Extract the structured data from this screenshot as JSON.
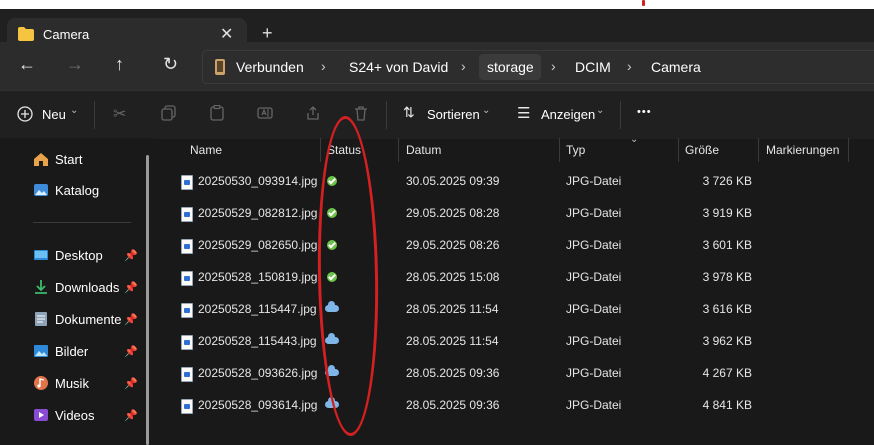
{
  "tab": {
    "title": "Camera",
    "close_icon": "close-icon",
    "new_tab_icon": "plus-icon"
  },
  "nav": {
    "back_icon": "arrow-left-icon",
    "forward_icon": "arrow-right-icon",
    "up_icon": "arrow-up-icon",
    "refresh_icon": "refresh-icon"
  },
  "breadcrumb": [
    "Verbunden",
    "S24+ von David",
    "storage",
    "DCIM",
    "Camera"
  ],
  "toolbar": {
    "new_label": "Neu",
    "sort_label": "Sortieren",
    "view_label": "Anzeigen",
    "more_label": "•••"
  },
  "sidebar": {
    "items": [
      {
        "label": "Start",
        "icon": "home-icon",
        "pinned": false
      },
      {
        "label": "Katalog",
        "icon": "gallery-icon",
        "pinned": false
      },
      {
        "label": "Desktop",
        "icon": "desktop-icon",
        "pinned": true
      },
      {
        "label": "Downloads",
        "icon": "download-icon",
        "pinned": true
      },
      {
        "label": "Dokumente",
        "icon": "document-icon",
        "pinned": true
      },
      {
        "label": "Bilder",
        "icon": "pictures-icon",
        "pinned": true
      },
      {
        "label": "Musik",
        "icon": "music-icon",
        "pinned": true
      },
      {
        "label": "Videos",
        "icon": "video-icon",
        "pinned": true
      }
    ]
  },
  "columns": {
    "name": "Name",
    "status": "Status",
    "date": "Datum",
    "type": "Typ",
    "size": "Größe",
    "tags": "Markierungen"
  },
  "files": [
    {
      "name": "20250530_093914.jpg",
      "status": "synced",
      "date": "30.05.2025 09:39",
      "type": "JPG-Datei",
      "size": "3 726 KB"
    },
    {
      "name": "20250529_082812.jpg",
      "status": "synced",
      "date": "29.05.2025 08:28",
      "type": "JPG-Datei",
      "size": "3 919 KB"
    },
    {
      "name": "20250529_082650.jpg",
      "status": "synced",
      "date": "29.05.2025 08:26",
      "type": "JPG-Datei",
      "size": "3 601 KB"
    },
    {
      "name": "20250528_150819.jpg",
      "status": "synced",
      "date": "28.05.2025 15:08",
      "type": "JPG-Datei",
      "size": "3 978 KB"
    },
    {
      "name": "20250528_115447.jpg",
      "status": "cloud",
      "date": "28.05.2025 11:54",
      "type": "JPG-Datei",
      "size": "3 616 KB"
    },
    {
      "name": "20250528_115443.jpg",
      "status": "cloud",
      "date": "28.05.2025 11:54",
      "type": "JPG-Datei",
      "size": "3 962 KB"
    },
    {
      "name": "20250528_093626.jpg",
      "status": "cloud",
      "date": "28.05.2025 09:36",
      "type": "JPG-Datei",
      "size": "4 267 KB"
    },
    {
      "name": "20250528_093614.jpg",
      "status": "cloud",
      "date": "28.05.2025 09:36",
      "type": "JPG-Datei",
      "size": "4 841 KB"
    }
  ],
  "colors": {
    "annotation_red": "#d42020",
    "synced_green": "#6cc24a",
    "cloud_blue": "#7fb6ea",
    "folder_yellow": "#f5c542"
  }
}
